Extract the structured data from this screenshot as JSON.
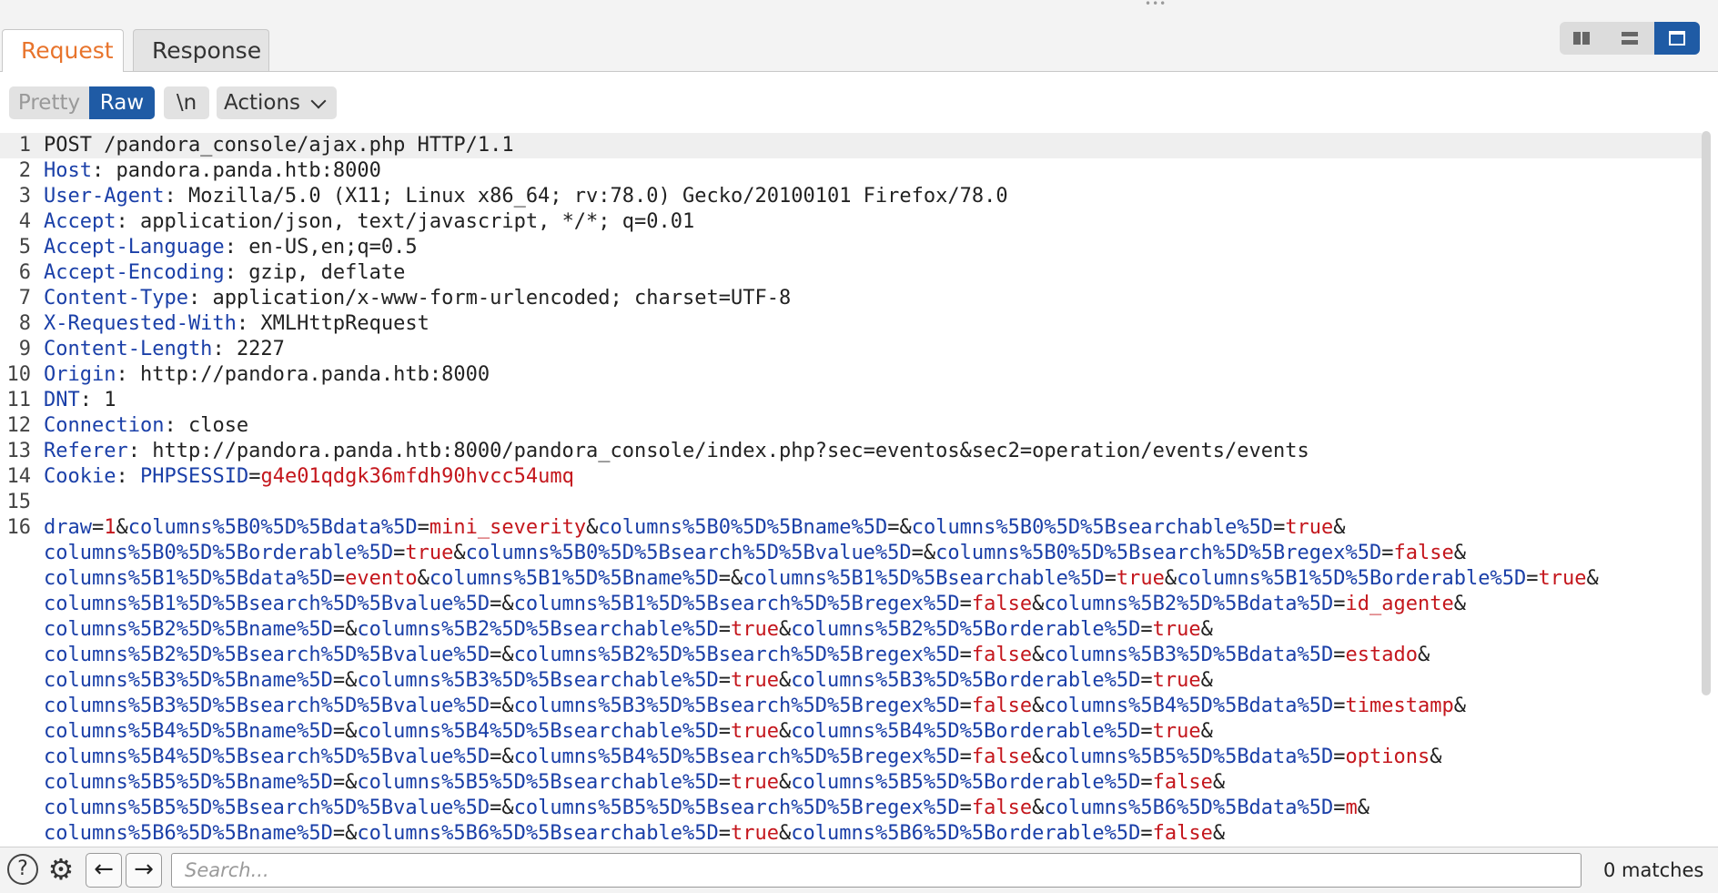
{
  "tabs": [
    {
      "label": "Request",
      "active": true
    },
    {
      "label": "Response",
      "active": false
    }
  ],
  "view_modes": [
    "split-horizontal",
    "split-vertical",
    "single"
  ],
  "toolbar": {
    "pretty": "Pretty",
    "raw": "Raw",
    "newline": "\\n",
    "actions": "Actions"
  },
  "request": {
    "request_line": "POST /pandora_console/ajax.php HTTP/1.1",
    "headers": [
      {
        "name": "Host",
        "value": "pandora.panda.htb:8000"
      },
      {
        "name": "User-Agent",
        "value": "Mozilla/5.0 (X11; Linux x86_64; rv:78.0) Gecko/20100101 Firefox/78.0"
      },
      {
        "name": "Accept",
        "value": "application/json, text/javascript, */*; q=0.01"
      },
      {
        "name": "Accept-Language",
        "value": "en-US,en;q=0.5"
      },
      {
        "name": "Accept-Encoding",
        "value": "gzip, deflate"
      },
      {
        "name": "Content-Type",
        "value": "application/x-www-form-urlencoded; charset=UTF-8"
      },
      {
        "name": "X-Requested-With",
        "value": "XMLHttpRequest"
      },
      {
        "name": "Content-Length",
        "value": "2227"
      },
      {
        "name": "Origin",
        "value": "http://pandora.panda.htb:8000"
      },
      {
        "name": "DNT",
        "value": "1"
      },
      {
        "name": "Connection",
        "value": "close"
      },
      {
        "name": "Referer",
        "value": "http://pandora.panda.htb:8000/pandora_console/index.php?sec=eventos&sec2=operation/events/events"
      }
    ],
    "cookie": {
      "header": "Cookie",
      "name": "PHPSESSID",
      "value": "g4e01qdgk36mfdh90hvcc54umq"
    },
    "body_lines": [
      [
        [
          "draw",
          "1"
        ],
        [
          "columns%5B0%5D%5Bdata%5D",
          "mini_severity"
        ],
        [
          "columns%5B0%5D%5Bname%5D",
          ""
        ],
        [
          "columns%5B0%5D%5Bsearchable%5D",
          "true"
        ],
        [
          "",
          ""
        ]
      ],
      [
        [
          "columns%5B0%5D%5Borderable%5D",
          "true"
        ],
        [
          "columns%5B0%5D%5Bsearch%5D%5Bvalue%5D",
          ""
        ],
        [
          "columns%5B0%5D%5Bsearch%5D%5Bregex%5D",
          "false"
        ],
        [
          "",
          ""
        ]
      ],
      [
        [
          "columns%5B1%5D%5Bdata%5D",
          "evento"
        ],
        [
          "columns%5B1%5D%5Bname%5D",
          ""
        ],
        [
          "columns%5B1%5D%5Bsearchable%5D",
          "true"
        ],
        [
          "columns%5B1%5D%5Borderable%5D",
          "true"
        ],
        [
          "",
          ""
        ]
      ],
      [
        [
          "columns%5B1%5D%5Bsearch%5D%5Bvalue%5D",
          ""
        ],
        [
          "columns%5B1%5D%5Bsearch%5D%5Bregex%5D",
          "false"
        ],
        [
          "columns%5B2%5D%5Bdata%5D",
          "id_agente"
        ],
        [
          "",
          ""
        ]
      ],
      [
        [
          "columns%5B2%5D%5Bname%5D",
          ""
        ],
        [
          "columns%5B2%5D%5Bsearchable%5D",
          "true"
        ],
        [
          "columns%5B2%5D%5Borderable%5D",
          "true"
        ],
        [
          "",
          ""
        ]
      ],
      [
        [
          "columns%5B2%5D%5Bsearch%5D%5Bvalue%5D",
          ""
        ],
        [
          "columns%5B2%5D%5Bsearch%5D%5Bregex%5D",
          "false"
        ],
        [
          "columns%5B3%5D%5Bdata%5D",
          "estado"
        ],
        [
          "",
          ""
        ]
      ],
      [
        [
          "columns%5B3%5D%5Bname%5D",
          ""
        ],
        [
          "columns%5B3%5D%5Bsearchable%5D",
          "true"
        ],
        [
          "columns%5B3%5D%5Borderable%5D",
          "true"
        ],
        [
          "",
          ""
        ]
      ],
      [
        [
          "columns%5B3%5D%5Bsearch%5D%5Bvalue%5D",
          ""
        ],
        [
          "columns%5B3%5D%5Bsearch%5D%5Bregex%5D",
          "false"
        ],
        [
          "columns%5B4%5D%5Bdata%5D",
          "timestamp"
        ],
        [
          "",
          ""
        ]
      ],
      [
        [
          "columns%5B4%5D%5Bname%5D",
          ""
        ],
        [
          "columns%5B4%5D%5Bsearchable%5D",
          "true"
        ],
        [
          "columns%5B4%5D%5Borderable%5D",
          "true"
        ],
        [
          "",
          ""
        ]
      ],
      [
        [
          "columns%5B4%5D%5Bsearch%5D%5Bvalue%5D",
          ""
        ],
        [
          "columns%5B4%5D%5Bsearch%5D%5Bregex%5D",
          "false"
        ],
        [
          "columns%5B5%5D%5Bdata%5D",
          "options"
        ],
        [
          "",
          ""
        ]
      ],
      [
        [
          "columns%5B5%5D%5Bname%5D",
          ""
        ],
        [
          "columns%5B5%5D%5Bsearchable%5D",
          "true"
        ],
        [
          "columns%5B5%5D%5Borderable%5D",
          "false"
        ],
        [
          "",
          ""
        ]
      ],
      [
        [
          "columns%5B5%5D%5Bsearch%5D%5Bvalue%5D",
          ""
        ],
        [
          "columns%5B5%5D%5Bsearch%5D%5Bregex%5D",
          "false"
        ],
        [
          "columns%5B6%5D%5Bdata%5D",
          "m"
        ],
        [
          "",
          ""
        ]
      ],
      [
        [
          "columns%5B6%5D%5Bname%5D",
          ""
        ],
        [
          "columns%5B6%5D%5Bsearchable%5D",
          "true"
        ],
        [
          "columns%5B6%5D%5Borderable%5D",
          "false"
        ],
        [
          "",
          ""
        ]
      ]
    ]
  },
  "search": {
    "placeholder": "Search...",
    "value": "",
    "matches": "0 matches"
  },
  "colors": {
    "active_tab": "#e8742c",
    "accent": "#1f5ba5",
    "key": "#1a3fa8",
    "value": "#c4161c"
  }
}
